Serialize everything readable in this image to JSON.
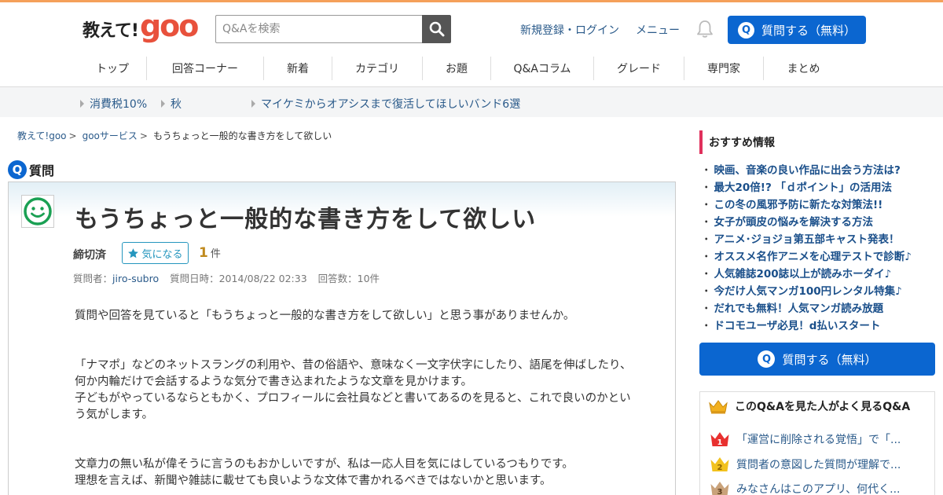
{
  "header": {
    "logo_text": "教えて!",
    "logo_goo": "goo",
    "search_placeholder": "Q&Aを検索",
    "register_login": "新規登録・ログイン",
    "menu": "メニュー",
    "ask_button": "質問する（無料）",
    "ask_badge": "Q"
  },
  "nav": {
    "items": [
      "トップ",
      "回答コーナー",
      "新着",
      "カテゴリ",
      "お題",
      "Q&Aコラム",
      "グレード",
      "専門家",
      "まとめ"
    ]
  },
  "trends": [
    "消費税10%",
    "秋",
    "マイケミからオアシスまで復活してほしいバンド6選"
  ],
  "breadcrumb": {
    "items": [
      "教えて!goo",
      "gooサービス"
    ],
    "separator": ">",
    "current": "もうちょっと一般的な書き方をして欲しい"
  },
  "question": {
    "section_label": "質問",
    "section_badge": "Q",
    "title": "もうちょっと一般的な書き方をして欲しい",
    "status": "締切済",
    "bookmark_label": "気になる",
    "bookmark_count": "1",
    "bookmark_unit": "件",
    "meta": {
      "asker_label": "質問者：",
      "asker": "jiro-subro",
      "date_label": "質問日時：",
      "date": "2014/08/22 02:33",
      "answers_label": "回答数：",
      "answers": "10件"
    },
    "body": {
      "p1": "質問や回答を見ていると「もうちょっと一般的な書き方をして欲しい」と思う事がありませんか。",
      "p2_l1": "「ナマポ」などのネットスラングの利用や、昔の俗語や、意味なく一文字伏字にしたり、語尾を伸ばしたり、",
      "p2_l2": "何か内輪だけで会話するような気分で書き込まれたような文章を見かけます。",
      "p2_l3": "子どもがやっているならともかく、プロフィールに会社員などと書いてあるのを見ると、これで良いのかとい",
      "p2_l4": "う気がします。",
      "p3_l1": "文章力の無い私が偉そうに言うのもおかしいですが、私は一応人目を気にはしているつもりです。",
      "p3_l2": "理想を言えば、新聞や雑誌に載せても良いような文体で書かれるべきではないかと思います。"
    }
  },
  "sidebar": {
    "recommend_title": "おすすめ情報",
    "bullet": "・",
    "recommend_items": [
      "映画、音楽の良い作品に出会う方法は?",
      "最大20倍!? 「ｄポイント」の活用法",
      "この冬の風邪予防に新たな対策法!!",
      "女子が頭皮の悩みを解決する方法",
      "アニメ･ジョジョ第五部キャスト発表！",
      "オススメ名作アニメを心理テストで診断♪",
      "人気雑誌200誌以上が読みホーダイ♪",
      "今だけ人気マンガ100円レンタル特集♪",
      "だれでも無料！人気マンガ読み放題",
      "ドコモユーザ必見！d払いスタート"
    ],
    "ask_button": "質問する（無料）",
    "ask_badge": "Q",
    "often_title": "このQ&Aを見た人がよく見るQ&A",
    "often_items": [
      "「運営に削除される覚悟」で「...",
      "質問者の意図した質問が理解で...",
      "みなさんはこのアプリ、何代く..."
    ],
    "rank_labels": [
      "1",
      "2",
      "3"
    ]
  },
  "colors": {
    "brand_blue": "#0b66d0",
    "goo_red": "#e8513c",
    "accent_pink": "#e0305c",
    "link_blue": "#2a5a8a",
    "bookmark_teal": "#2596be",
    "gold": "#c08a1e"
  },
  "icons": {
    "search": "search-icon",
    "bell": "bell-icon",
    "avatar": "smiley-icon",
    "bookmark": "star-icon",
    "crown": "crown-icon"
  }
}
